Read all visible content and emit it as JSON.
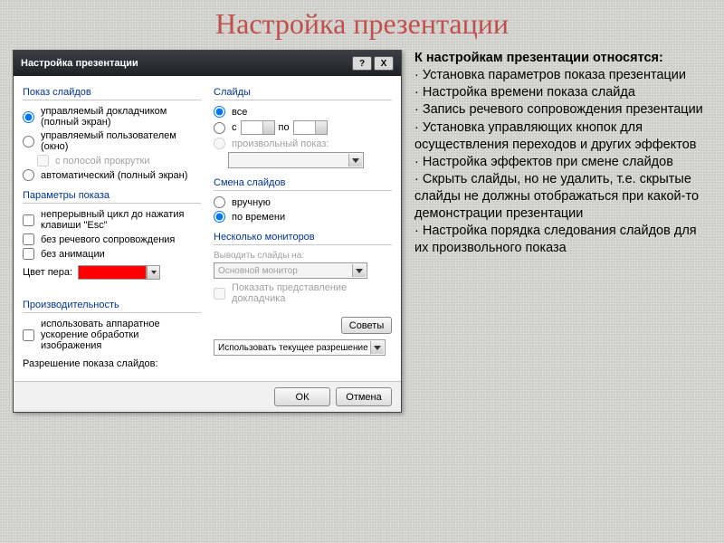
{
  "page_title": "Настройка презентации",
  "dialog": {
    "title": "Настройка презентации",
    "help": "?",
    "close": "X",
    "groups": {
      "show": {
        "title": "Показ слайдов",
        "opt_speaker": "управляемый докладчиком (полный экран)",
        "opt_user": "управляемый пользователем (окно)",
        "chk_scroll": "с полосой прокрутки",
        "opt_auto": "автоматический (полный экран)"
      },
      "slides": {
        "title": "Слайды",
        "opt_all": "все",
        "opt_from": "с",
        "lbl_to": "по",
        "opt_custom": "произвольный показ:"
      },
      "params": {
        "title": "Параметры показа",
        "chk_loop": "непрерывный цикл до нажатия клавиши \"Esc\"",
        "chk_narration": "без речевого сопровождения",
        "chk_anim": "без анимации",
        "pen_label": "Цвет пера:"
      },
      "advance": {
        "title": "Смена слайдов",
        "opt_manual": "вручную",
        "opt_timing": "по времени"
      },
      "monitors": {
        "title": "Несколько мониторов",
        "lbl_output": "Выводить слайды на:",
        "combo_value": "Основной монитор",
        "chk_presenter": "Показать представление докладчика"
      },
      "perf": {
        "title": "Производительность",
        "chk_hw": "использовать аппаратное ускорение обработки изображения",
        "tips_btn": "Советы",
        "res_label": "Разрешение показа слайдов:",
        "res_value": "Использовать текущее разрешение"
      }
    },
    "ok": "ОК",
    "cancel": "Отмена"
  },
  "info": {
    "heading": "К настройкам презентации относятся:",
    "li1": "·  Установка параметров показа презентации",
    "li2": "·  Настройка времени показа слайда",
    "li3": "·  Запись речевого сопровождения презентации",
    "li4": "·  Установка управляющих кнопок для осуществления переходов и других эффектов",
    "li5": "·  Настройка эффектов при смене слайдов",
    "li6": "·  Скрыть слайды, но не удалить, т.е. скрытые слайды не должны отображаться при какой-то демонстрации презентации",
    "li7": "·  Настройка порядка следования слайдов для их произвольного показа"
  }
}
